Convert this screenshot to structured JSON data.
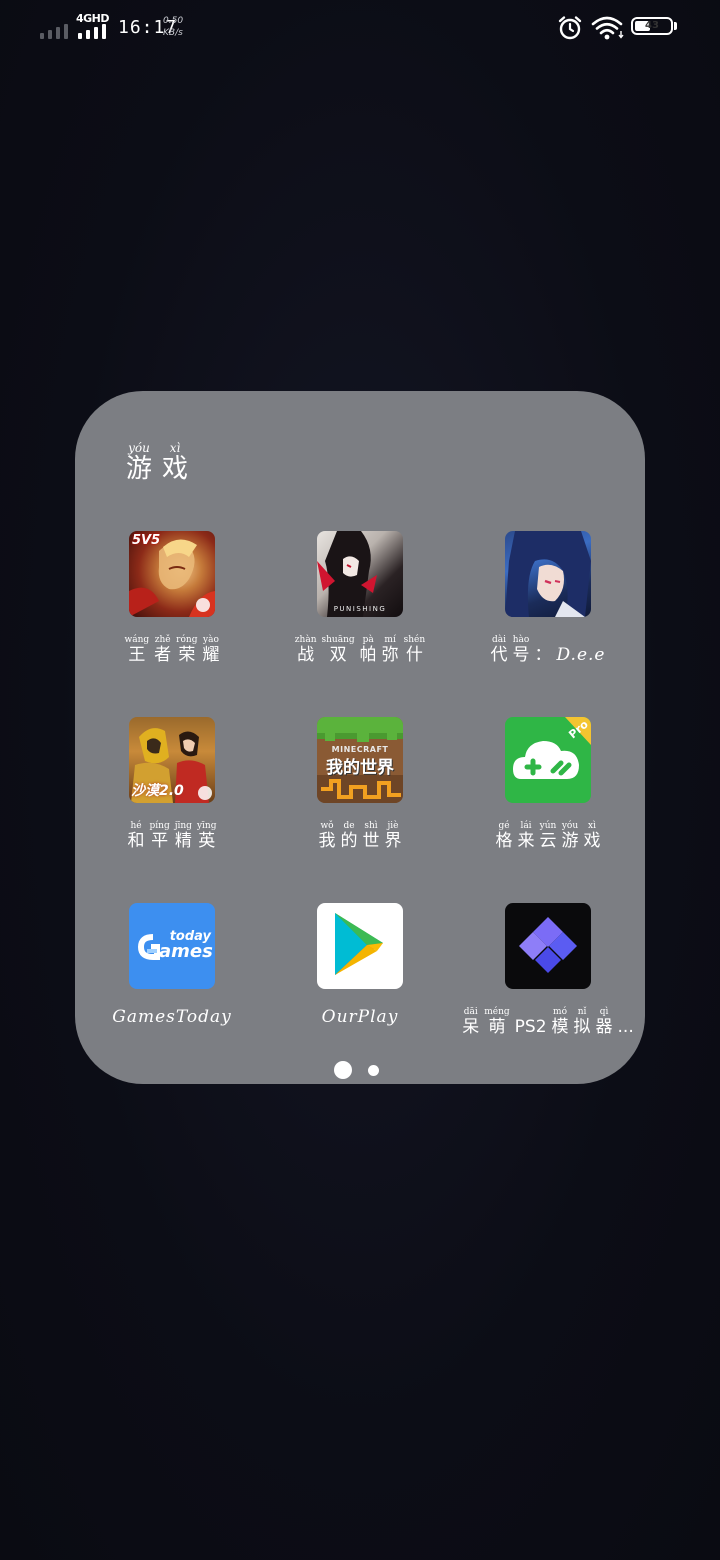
{
  "status_bar": {
    "network_type": "4GHD",
    "time": "16:17",
    "speed_value": "0.50",
    "speed_unit": "KB/s",
    "battery_level": "43",
    "battery_fraction": 0.43,
    "icons": [
      "signal-icon",
      "alarm-icon",
      "wifi-icon",
      "battery-icon"
    ]
  },
  "folder": {
    "title": [
      {
        "pinyin": "yóu",
        "char": "游"
      },
      {
        "pinyin": "xì",
        "char": "戏"
      }
    ],
    "apps": [
      {
        "name": "王者荣耀",
        "label": [
          {
            "pinyin": "wáng",
            "char": "王"
          },
          {
            "pinyin": "zhě",
            "char": "者"
          },
          {
            "pinyin": "róng",
            "char": "荣"
          },
          {
            "pinyin": "yào",
            "char": "耀"
          }
        ],
        "badge": "5V5"
      },
      {
        "name": "战双帕弥什",
        "label": [
          {
            "pinyin": "zhàn",
            "char": "战"
          },
          {
            "pinyin": "shuāng",
            "char": "双"
          },
          {
            "pinyin": "pà",
            "char": "帕"
          },
          {
            "pinyin": "mí",
            "char": "弥"
          },
          {
            "pinyin": "shén",
            "char": "什"
          }
        ],
        "badge": "PUNISHING"
      },
      {
        "name": "代号：D.e.e",
        "label": [
          {
            "pinyin": "dài",
            "char": "代"
          },
          {
            "pinyin": "hào",
            "char": "号"
          },
          {
            "pinyin": "",
            "char": "："
          }
        ],
        "label_suffix": "D.e.e"
      },
      {
        "name": "和平精英",
        "label": [
          {
            "pinyin": "hé",
            "char": "和"
          },
          {
            "pinyin": "píng",
            "char": "平"
          },
          {
            "pinyin": "jīng",
            "char": "精"
          },
          {
            "pinyin": "yīng",
            "char": "英"
          }
        ],
        "badge": "沙漠2.0"
      },
      {
        "name": "我的世界",
        "label": [
          {
            "pinyin": "wǒ",
            "char": "我"
          },
          {
            "pinyin": "de",
            "char": "的"
          },
          {
            "pinyin": "shì",
            "char": "世"
          },
          {
            "pinyin": "jiè",
            "char": "界"
          }
        ],
        "badge_top": "MINECRAFT",
        "badge": "我的世界"
      },
      {
        "name": "格来云游戏",
        "label": [
          {
            "pinyin": "gé",
            "char": "格"
          },
          {
            "pinyin": "lái",
            "char": "来"
          },
          {
            "pinyin": "yún",
            "char": "云"
          },
          {
            "pinyin": "yóu",
            "char": "游"
          },
          {
            "pinyin": "xì",
            "char": "戏"
          }
        ],
        "badge": "Pro"
      },
      {
        "name": "GamesToday",
        "label": [],
        "label_suffix": "GamesToday",
        "badge_top": "today",
        "badge": "ames"
      },
      {
        "name": "OurPlay",
        "label": [],
        "label_suffix": "OurPlay"
      },
      {
        "name": "呆萌PS2模拟器...",
        "label": [
          {
            "pinyin": "dāi",
            "char": "呆"
          },
          {
            "pinyin": "méng",
            "char": "萌"
          },
          {
            "pinyin": "",
            "char": "PS2"
          },
          {
            "pinyin": "mó",
            "char": "模"
          },
          {
            "pinyin": "nǐ",
            "char": "拟"
          },
          {
            "pinyin": "qì",
            "char": "器"
          },
          {
            "pinyin": "",
            "char": "..."
          }
        ]
      }
    ],
    "page_count": 2,
    "current_page": 1
  },
  "colors": {
    "folder_bg": "#7c7e83",
    "wallpaper": "#0d0e17",
    "gameslink_green": "#2fb646",
    "gamestoday_blue": "#3d8ff0",
    "ps2_purple": "#5b5cf2"
  }
}
